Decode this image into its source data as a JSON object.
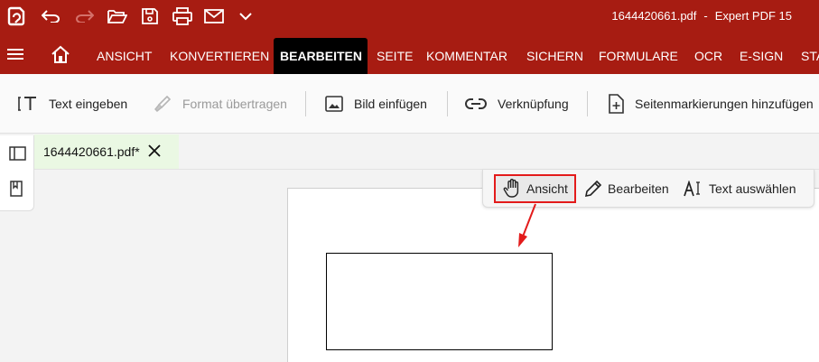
{
  "titlebar": {
    "filename": "1644420661.pdf",
    "separator": "-",
    "app_name": "Expert PDF 15",
    "quick_access": [
      "app-logo-icon",
      "undo-icon",
      "redo-icon",
      "open-folder-icon",
      "save-icon",
      "print-icon",
      "email-icon",
      "chevron-down-icon"
    ]
  },
  "ribbon": {
    "tabs": [
      "ANSICHT",
      "KONVERTIEREN",
      "BEARBEITEN",
      "SEITE",
      "KOMMENTAR",
      "SICHERN",
      "FORMULARE",
      "OCR",
      "E-SIGN",
      "STA"
    ],
    "active_tab": "BEARBEITEN"
  },
  "toolbar": {
    "text_eingeben": "Text eingeben",
    "format_uebertragen": "Format übertragen",
    "bild_einfuegen": "Bild einfügen",
    "verknuepfung": "Verknüpfung",
    "seitenmarkierungen": "Seitenmarkierungen hinzufügen"
  },
  "document_tab": {
    "title": "1644420661.pdf*"
  },
  "modes": {
    "ansicht": "Ansicht",
    "bearbeiten": "Bearbeiten",
    "text_auswaehlen": "Text auswählen",
    "selected": "Ansicht"
  },
  "colors": {
    "brand": "#a71c12",
    "highlight": "#e31b1b",
    "doc_tab_bg": "#eaf8e3"
  }
}
